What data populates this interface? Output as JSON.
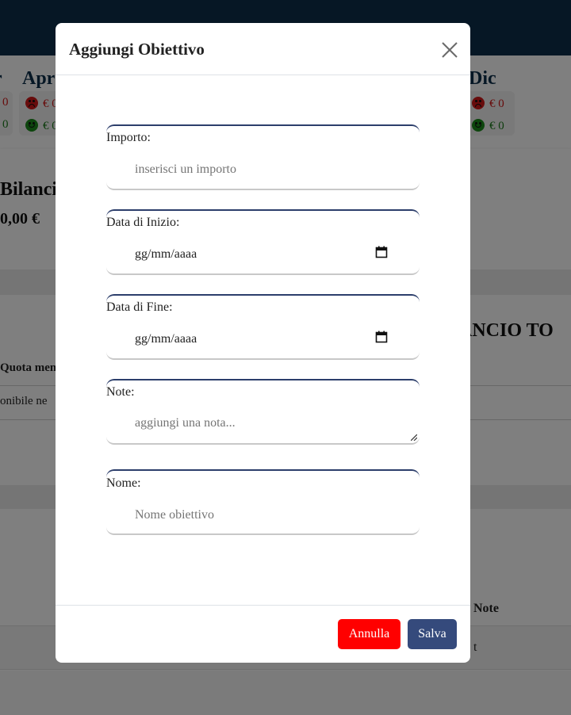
{
  "background": {
    "months": [
      {
        "name": "Apr",
        "expense": "€ 0",
        "income": "€ 0"
      },
      {
        "name": "Dic",
        "expense": "€ 0",
        "income": "€ 0"
      }
    ],
    "prev_month_expense_tail": "0",
    "prev_month_income_tail": "0",
    "prev_month_name_tail": "r",
    "bilancio_title": "Bilanci",
    "bilancio_value": "0,00 €",
    "quota_header": "Quota men",
    "disponibile_text": "onibile ne",
    "bilancio_totale": "ANCIO TO",
    "note_header": "Note",
    "row_text": "t"
  },
  "modal": {
    "title": "Aggiungi Obiettivo",
    "fields": [
      {
        "label": "Importo:",
        "placeholder": "inserisci un importo"
      },
      {
        "label": "Data di Inizio:",
        "value": "gg/mm/aaaa"
      },
      {
        "label": "Data di Fine:",
        "value": "gg/mm/aaaa"
      },
      {
        "label": "Note:",
        "placeholder": "aggiungi una nota..."
      },
      {
        "label": "Nome:",
        "placeholder": "Nome obiettivo"
      }
    ],
    "buttons": {
      "cancel": "Annulla",
      "save": "Salva"
    }
  },
  "colors": {
    "topbar": "#0c2f4a",
    "cancel": "#ff0000",
    "save": "#354a7c",
    "expense": "#d01818",
    "income": "#1a7a1a"
  }
}
